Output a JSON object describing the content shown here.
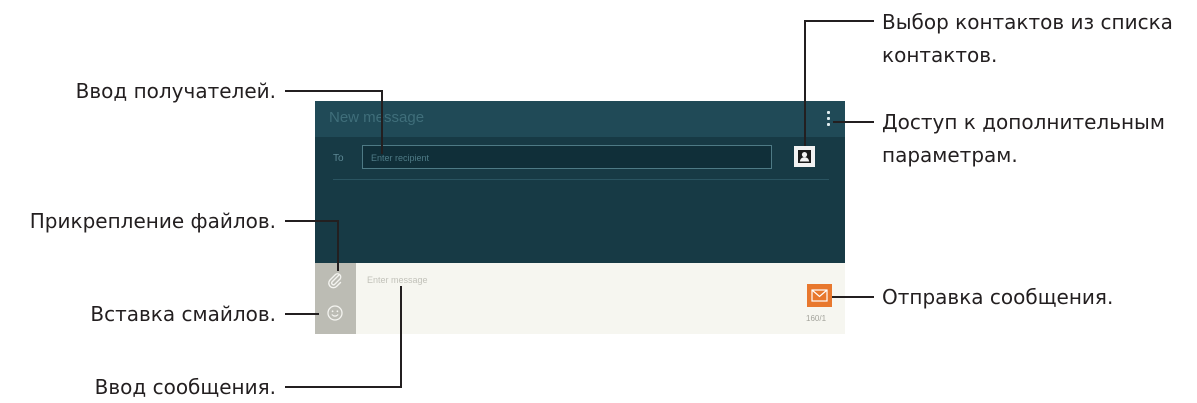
{
  "screen": {
    "title": "New message",
    "to_label": "To",
    "recipient_placeholder": "Enter recipient",
    "message_placeholder": "Enter message",
    "counter": "160/1"
  },
  "callouts": {
    "recipients": "Ввод получателей.",
    "attach": "Прикрепление файлов.",
    "emoticons": "Вставка смайлов.",
    "message": "Ввод сообщения.",
    "contacts_line1": "Выбор контактов из списка",
    "contacts_line2": "контактов.",
    "options_line1": "Доступ к дополнительным",
    "options_line2": "параметрам.",
    "send": "Отправка сообщения."
  },
  "icons": {
    "menu": "more-options-icon",
    "contact": "contact-picker-icon",
    "attach": "paperclip-icon",
    "emoticon": "smiley-icon",
    "send": "send-envelope-icon"
  },
  "colors": {
    "screen_bg": "#173a45",
    "appbar_bg": "#204a57",
    "compose_bg": "#f6f6f0",
    "tool_strip": "#bcbcb4",
    "send_accent": "#e8782e"
  }
}
